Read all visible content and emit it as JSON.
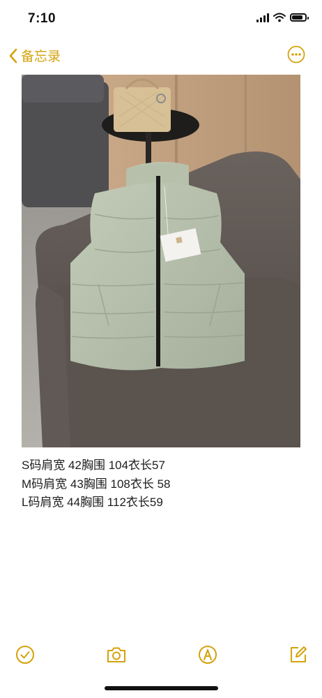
{
  "status_bar": {
    "time": "7:10",
    "battery_level": 0.85
  },
  "nav": {
    "back_label": "备忘录"
  },
  "note": {
    "lines": [
      "S码肩宽 42胸围 104衣长57",
      "M码肩宽 43胸围 108衣长 58",
      "L码肩宽 44胸围 112衣长59"
    ]
  },
  "toolbar": {
    "icons": [
      "checklist-icon",
      "camera-icon",
      "markup-icon",
      "compose-icon"
    ]
  },
  "colors": {
    "accent": "#d4a20b"
  }
}
